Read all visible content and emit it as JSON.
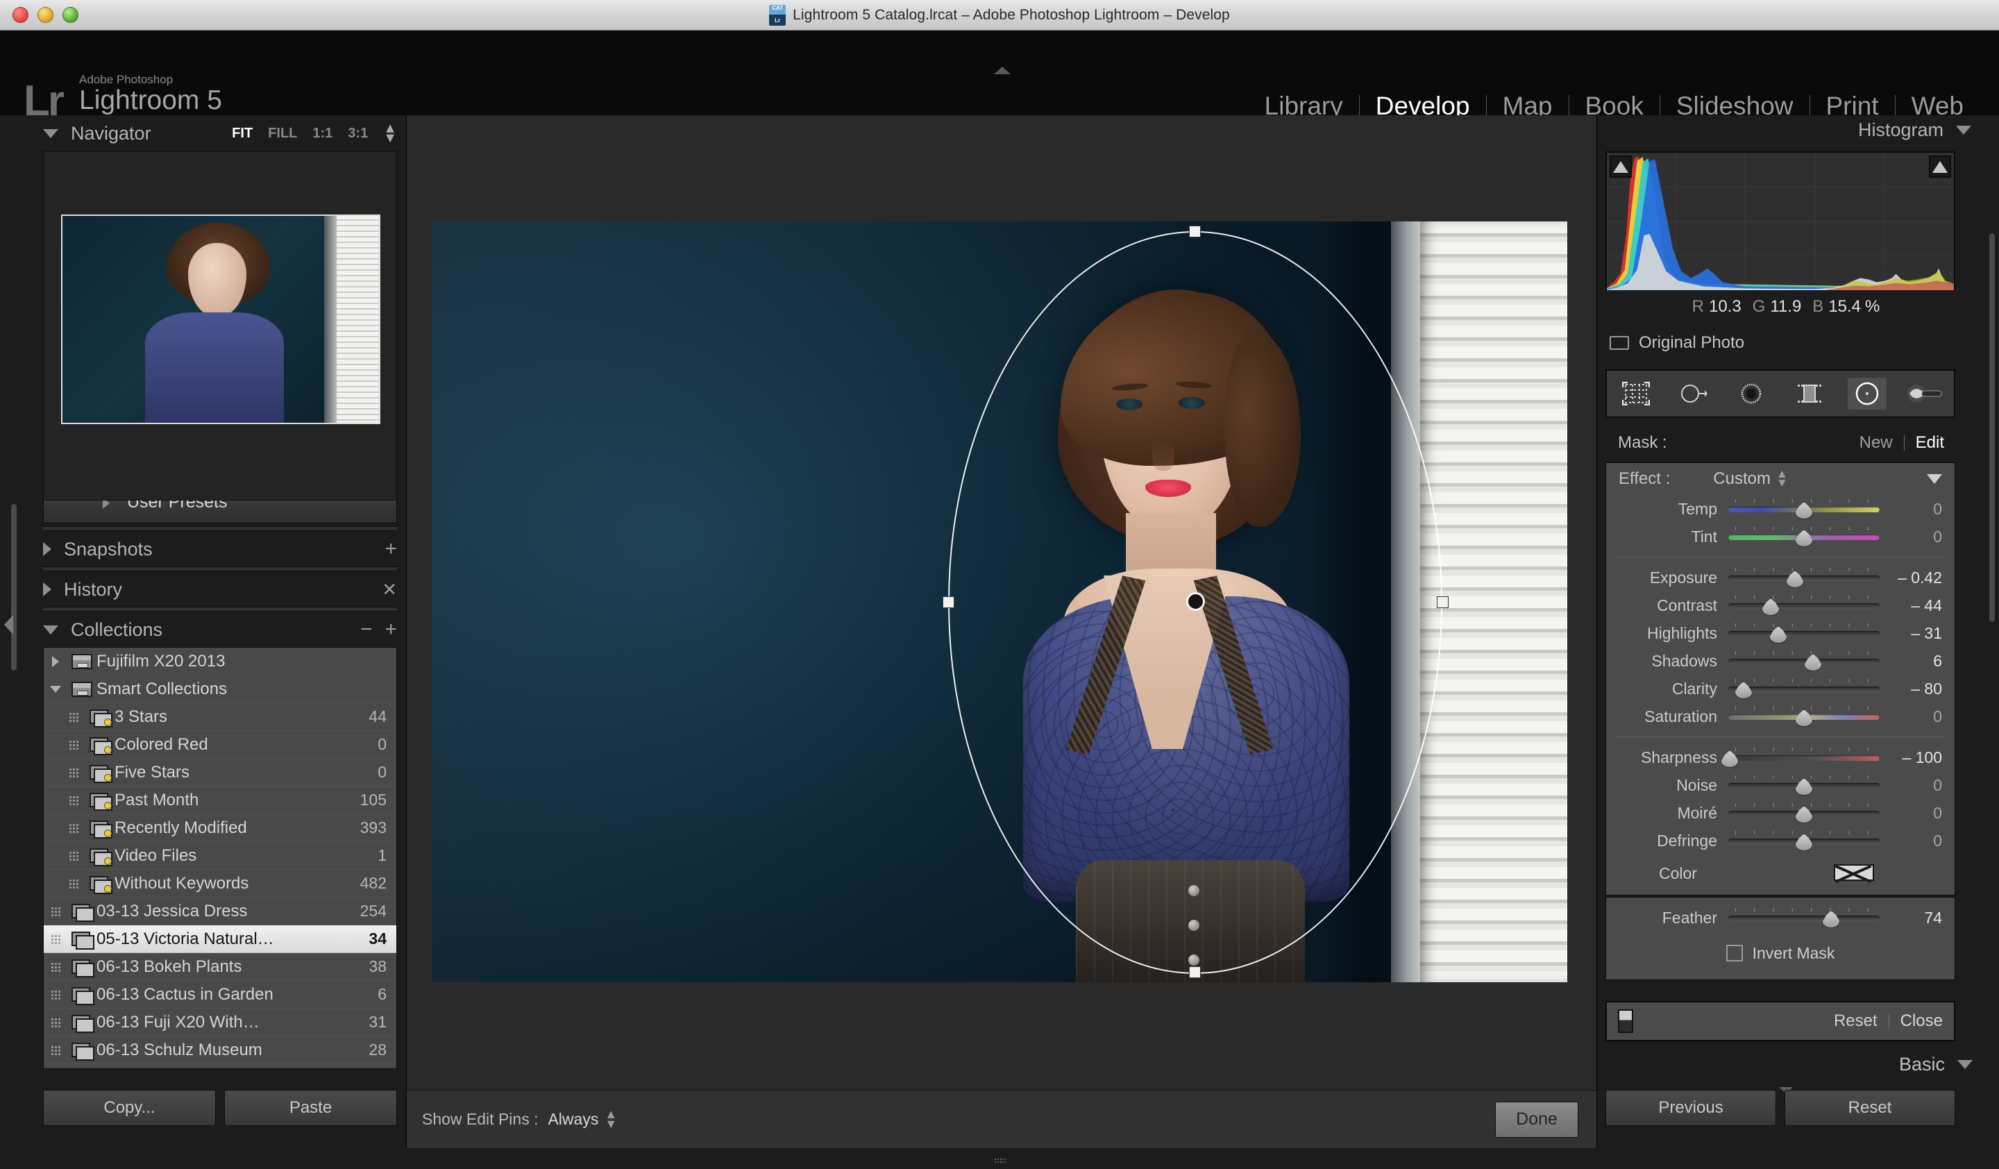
{
  "window": {
    "title": "Lightroom 5 Catalog.lrcat – Adobe Photoshop Lightroom – Develop",
    "catalog_icon_top": "CAT",
    "catalog_icon_bottom": "Lr"
  },
  "identity": {
    "mark": "Lr",
    "subtitle": "Adobe Photoshop",
    "product": "Lightroom 5"
  },
  "modules": [
    {
      "label": "Library",
      "active": false
    },
    {
      "label": "Develop",
      "active": true
    },
    {
      "label": "Map",
      "active": false
    },
    {
      "label": "Book",
      "active": false
    },
    {
      "label": "Slideshow",
      "active": false
    },
    {
      "label": "Print",
      "active": false
    },
    {
      "label": "Web",
      "active": false
    }
  ],
  "navigator": {
    "title": "Navigator",
    "zoom_options": [
      {
        "label": "FIT",
        "active": true
      },
      {
        "label": "FILL",
        "active": false
      },
      {
        "label": "1:1",
        "active": false
      },
      {
        "label": "3:1",
        "active": false
      }
    ]
  },
  "presets": {
    "user_presets_label": "User Presets"
  },
  "snapshots": {
    "title": "Snapshots",
    "add_icon": "plus-icon"
  },
  "history": {
    "title": "History",
    "clear_icon": "x-icon"
  },
  "collections": {
    "title": "Collections",
    "remove_icon": "minus-icon",
    "add_icon": "plus-icon",
    "items": [
      {
        "label": "Fujifilm X20 2013",
        "count": "",
        "indent": 1,
        "disclosure": "right",
        "icon": "collection-set-icon",
        "smart": false,
        "selected": false
      },
      {
        "label": "Smart Collections",
        "count": "",
        "indent": 1,
        "disclosure": "down",
        "icon": "collection-set-icon",
        "smart": false,
        "selected": false
      },
      {
        "label": "3 Stars",
        "count": "44",
        "indent": 2,
        "disclosure": "dots",
        "icon": "smart-collection-icon",
        "smart": true,
        "selected": false
      },
      {
        "label": "Colored Red",
        "count": "0",
        "indent": 2,
        "disclosure": "dots",
        "icon": "smart-collection-icon",
        "smart": true,
        "selected": false
      },
      {
        "label": "Five Stars",
        "count": "0",
        "indent": 2,
        "disclosure": "dots",
        "icon": "smart-collection-icon",
        "smart": true,
        "selected": false
      },
      {
        "label": "Past Month",
        "count": "105",
        "indent": 2,
        "disclosure": "dots",
        "icon": "smart-collection-icon",
        "smart": true,
        "selected": false
      },
      {
        "label": "Recently Modified",
        "count": "393",
        "indent": 2,
        "disclosure": "dots",
        "icon": "smart-collection-icon",
        "smart": true,
        "selected": false
      },
      {
        "label": "Video Files",
        "count": "1",
        "indent": 2,
        "disclosure": "dots",
        "icon": "smart-collection-icon",
        "smart": true,
        "selected": false
      },
      {
        "label": "Without Keywords",
        "count": "482",
        "indent": 2,
        "disclosure": "dots",
        "icon": "smart-collection-icon",
        "smart": true,
        "selected": false
      },
      {
        "label": "03-13 Jessica Dress",
        "count": "254",
        "indent": 1,
        "disclosure": "dots",
        "icon": "collection-icon",
        "smart": false,
        "selected": false
      },
      {
        "label": "05-13 Victoria Natural…",
        "count": "34",
        "indent": 1,
        "disclosure": "dots",
        "icon": "collection-icon",
        "smart": false,
        "selected": true
      },
      {
        "label": "06-13 Bokeh Plants",
        "count": "38",
        "indent": 1,
        "disclosure": "dots",
        "icon": "collection-icon",
        "smart": false,
        "selected": false
      },
      {
        "label": "06-13 Cactus in Garden",
        "count": "6",
        "indent": 1,
        "disclosure": "dots",
        "icon": "collection-icon",
        "smart": false,
        "selected": false
      },
      {
        "label": "06-13 Fuji X20 With…",
        "count": "31",
        "indent": 1,
        "disclosure": "dots",
        "icon": "collection-icon",
        "smart": false,
        "selected": false
      },
      {
        "label": "06-13 Schulz Museum",
        "count": "28",
        "indent": 1,
        "disclosure": "dots",
        "icon": "collection-icon",
        "smart": false,
        "selected": false
      }
    ]
  },
  "left_buttons": {
    "copy": "Copy...",
    "paste": "Paste"
  },
  "center_toolbar": {
    "edit_pins_label": "Show Edit Pins :",
    "edit_pins_value": "Always",
    "done": "Done"
  },
  "histogram": {
    "title": "Histogram",
    "r_label": "R",
    "r_value": "10.3",
    "g_label": "G",
    "g_value": "11.9",
    "b_label": "B",
    "b_value": "15.4",
    "percent": "%",
    "original_photo": "Original Photo",
    "shadow_clip_icon": "clipping-triangle-icon",
    "highlight_clip_icon": "clipping-triangle-icon"
  },
  "tools": [
    {
      "name": "crop-overlay-icon",
      "active": false
    },
    {
      "name": "spot-removal-icon",
      "active": false
    },
    {
      "name": "red-eye-correction-icon",
      "active": false
    },
    {
      "name": "graduated-filter-icon",
      "active": false
    },
    {
      "name": "radial-filter-icon",
      "active": true
    },
    {
      "name": "adjustment-brush-icon",
      "active": false
    }
  ],
  "mask": {
    "label": "Mask :",
    "new": "New",
    "edit": "Edit"
  },
  "effect": {
    "label": "Effect :",
    "value": "Custom",
    "groups": [
      {
        "sliders": [
          {
            "name": "Temp",
            "value": "0",
            "pos": 50,
            "track": "grad-temp",
            "zero": true
          },
          {
            "name": "Tint",
            "value": "0",
            "pos": 50,
            "track": "grad-tint",
            "zero": true
          }
        ]
      },
      {
        "sliders": [
          {
            "name": "Exposure",
            "value": "– 0.42",
            "pos": 44,
            "track": "",
            "zero": false
          },
          {
            "name": "Contrast",
            "value": "– 44",
            "pos": 28,
            "track": "",
            "zero": false
          },
          {
            "name": "Highlights",
            "value": "– 31",
            "pos": 33,
            "track": "",
            "zero": false
          },
          {
            "name": "Shadows",
            "value": "6",
            "pos": 56,
            "track": "",
            "zero": false
          },
          {
            "name": "Clarity",
            "value": "– 80",
            "pos": 10,
            "track": "",
            "zero": false
          },
          {
            "name": "Saturation",
            "value": "0",
            "pos": 50,
            "track": "grad-sat",
            "zero": true
          }
        ]
      },
      {
        "sliders": [
          {
            "name": "Sharpness",
            "value": "– 100",
            "pos": 1,
            "track": "grad-sharp",
            "zero": false
          },
          {
            "name": "Noise",
            "value": "0",
            "pos": 50,
            "track": "",
            "zero": true
          },
          {
            "name": "Moiré",
            "value": "0",
            "pos": 50,
            "track": "",
            "zero": true
          },
          {
            "name": "Defringe",
            "value": "0",
            "pos": 50,
            "track": "",
            "zero": true
          }
        ]
      }
    ],
    "color_label": "Color",
    "color_swatch_icon": "no-color-swatch-icon"
  },
  "feather": {
    "name": "Feather",
    "value": "74",
    "pos": 68,
    "invert_label": "Invert Mask",
    "invert_checked": false
  },
  "reset_close": {
    "switch_icon": "toggle-switch-icon",
    "reset": "Reset",
    "close": "Close"
  },
  "basic": {
    "title": "Basic"
  },
  "right_buttons": {
    "previous": "Previous",
    "reset": "Reset"
  },
  "colors": {
    "panel_bg": "#1c1c1c",
    "effect_bg": "#4b4b4b",
    "canvas_bg": "#2a2a2a",
    "selection": "#f2f2f2",
    "accent_text": "#ffffff"
  }
}
